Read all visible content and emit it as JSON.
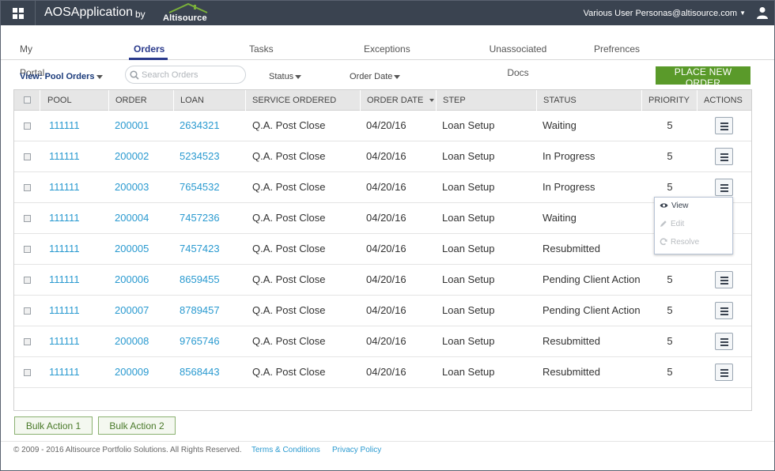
{
  "header": {
    "app_name": "AOSApplication",
    "by": "by",
    "logo_text": "Altisource",
    "user_email": "Various User Personas@altisource.com",
    "user_caret": "▼",
    "grid_icon": "grid-icon",
    "user_icon": "user-icon"
  },
  "tabs": [
    {
      "label": "My Portal",
      "active": false
    },
    {
      "label": "Orders",
      "active": true
    },
    {
      "label": "Tasks",
      "active": false
    },
    {
      "label": "Exceptions",
      "active": false
    },
    {
      "label": "Unassociated Docs",
      "active": false
    },
    {
      "label": "Prefrences",
      "active": false
    }
  ],
  "toolbar": {
    "view_label": "View: Pool Orders",
    "search_placeholder": "Search Orders",
    "status_label": "Status",
    "order_date_label": "Order Date",
    "place_order_label": "PLACE NEW ORDER"
  },
  "table": {
    "columns": [
      "POOL",
      "ORDER",
      "LOAN",
      "SERVICE ORDERED",
      "ORDER DATE",
      "STEP",
      "STATUS",
      "PRIORITY",
      "ACTIONS"
    ],
    "rows": [
      {
        "pool": "111111",
        "order": "200001",
        "loan": "2634321",
        "service": "Q.A. Post Close",
        "date": "04/20/16",
        "step": "Loan Setup",
        "status": "Waiting",
        "priority": "5"
      },
      {
        "pool": "111111",
        "order": "200002",
        "loan": "5234523",
        "service": "Q.A. Post Close",
        "date": "04/20/16",
        "step": "Loan Setup",
        "status": "In Progress",
        "priority": "5"
      },
      {
        "pool": "111111",
        "order": "200003",
        "loan": "7654532",
        "service": "Q.A. Post Close",
        "date": "04/20/16",
        "step": "Loan Setup",
        "status": "In Progress",
        "priority": "5"
      },
      {
        "pool": "111111",
        "order": "200004",
        "loan": "7457236",
        "service": "Q.A. Post Close",
        "date": "04/20/16",
        "step": "Loan Setup",
        "status": "Waiting",
        "priority": ""
      },
      {
        "pool": "111111",
        "order": "200005",
        "loan": "7457423",
        "service": "Q.A. Post Close",
        "date": "04/20/16",
        "step": "Loan Setup",
        "status": "Resubmitted",
        "priority": ""
      },
      {
        "pool": "111111",
        "order": "200006",
        "loan": "8659455",
        "service": "Q.A. Post Close",
        "date": "04/20/16",
        "step": "Loan Setup",
        "status": "Pending Client Action",
        "priority": "5"
      },
      {
        "pool": "111111",
        "order": "200007",
        "loan": "8789457",
        "service": "Q.A. Post Close",
        "date": "04/20/16",
        "step": "Loan Setup",
        "status": "Pending Client Action",
        "priority": "5"
      },
      {
        "pool": "111111",
        "order": "200008",
        "loan": "9765746",
        "service": "Q.A. Post Close",
        "date": "04/20/16",
        "step": "Loan Setup",
        "status": "Resubmitted",
        "priority": "5"
      },
      {
        "pool": "111111",
        "order": "200009",
        "loan": "8568443",
        "service": "Q.A. Post Close",
        "date": "04/20/16",
        "step": "Loan Setup",
        "status": "Resubmitted",
        "priority": "5"
      }
    ]
  },
  "actions_menu": {
    "items": [
      {
        "label": "View",
        "icon": "eye-icon",
        "enabled": true
      },
      {
        "label": "Edit",
        "icon": "pencil-icon",
        "enabled": false
      },
      {
        "label": "Resolve",
        "icon": "refresh-icon",
        "enabled": false
      }
    ]
  },
  "bulk_actions": [
    "Bulk Action 1",
    "Bulk Action 2"
  ],
  "footer": {
    "copyright": "© 2009 - 2016 Altisource Portfolio Solutions. All Rights Reserved.",
    "terms": "Terms & Conditions",
    "privacy": "Privacy Policy"
  },
  "colors": {
    "header_bg": "#3a4350",
    "accent": "#2a3a8c",
    "link": "#2a9ad0",
    "primary_button": "#5a9a2a"
  }
}
